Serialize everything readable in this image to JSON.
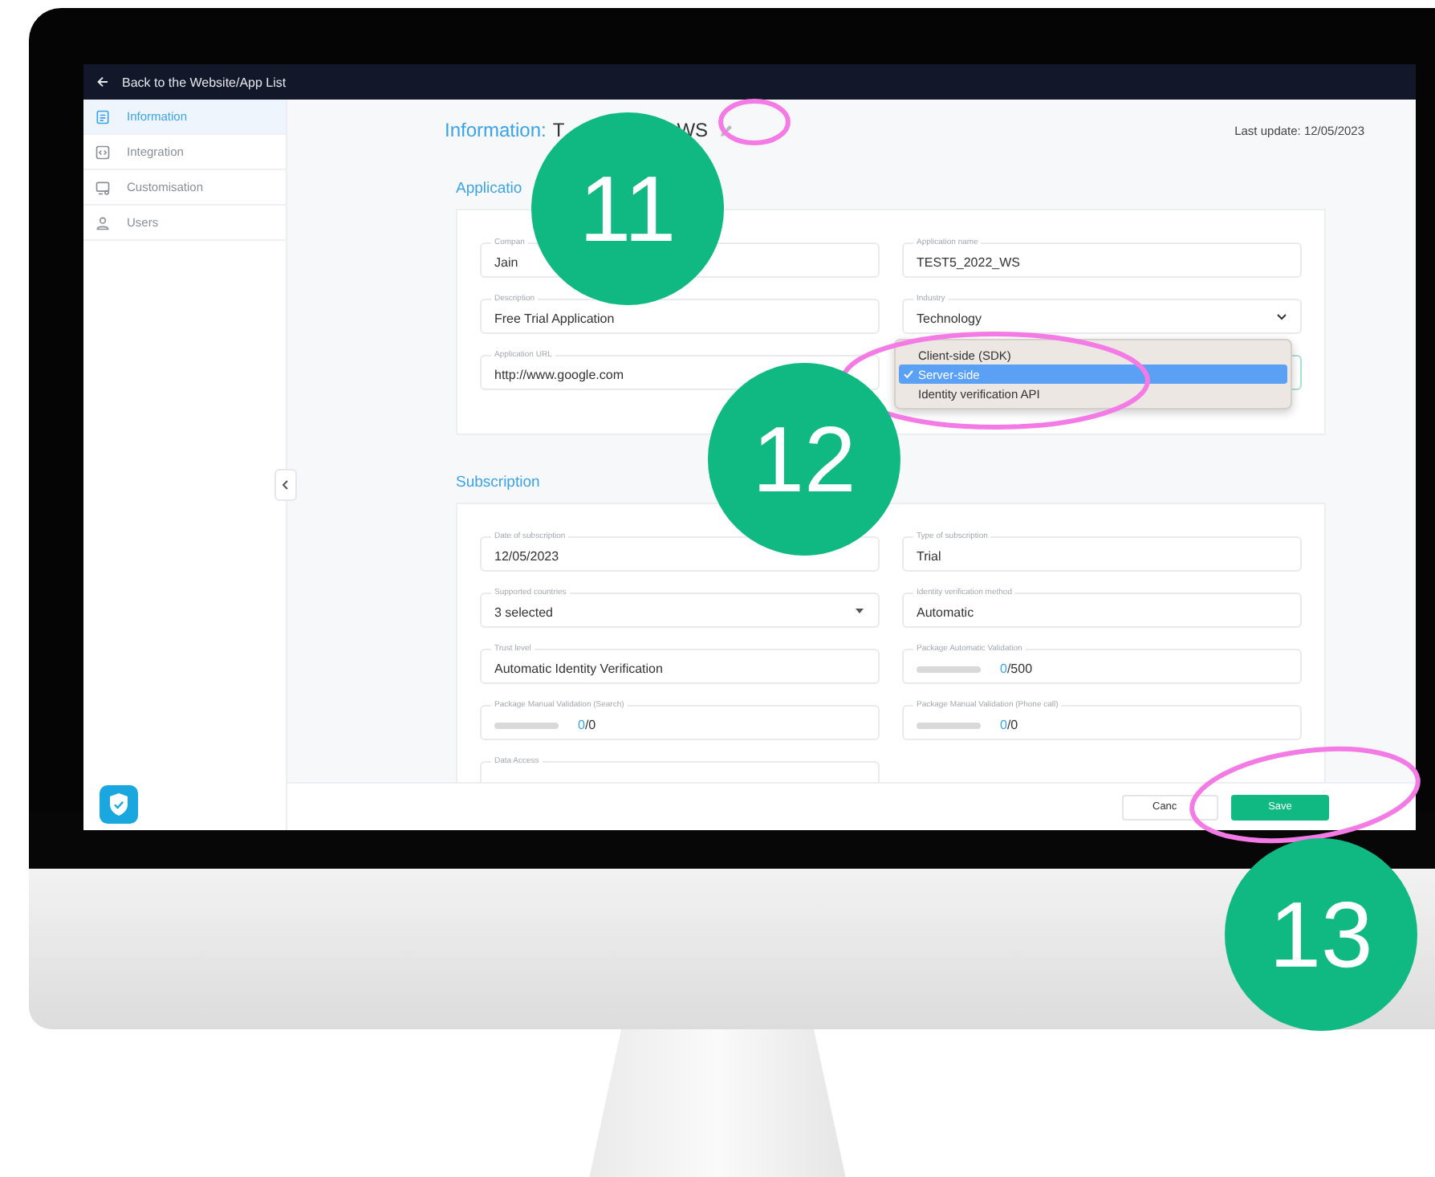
{
  "top_bar": {
    "back_link": "Back to the Website/App List"
  },
  "sidebar": {
    "items": [
      {
        "label": "Information",
        "selected": true
      },
      {
        "label": "Integration",
        "selected": false
      },
      {
        "label": "Customisation",
        "selected": false
      },
      {
        "label": "Users",
        "selected": false
      }
    ]
  },
  "header": {
    "title_label": "Information:",
    "title_name_start": "T",
    "title_name_end": "WS",
    "last_update": "Last update: 12/05/2023"
  },
  "sections": [
    {
      "title": "Applicatio",
      "fields": [
        {
          "kind": "text",
          "label": "Compan",
          "value": "Jain"
        },
        {
          "kind": "text",
          "label": "Application name",
          "value": "TEST5_2022_WS"
        },
        {
          "kind": "text",
          "label": "Description",
          "value": "Free Trial Application"
        },
        {
          "kind": "select",
          "label": "Industry",
          "value": "Technology"
        },
        {
          "kind": "text",
          "label": "Application URL",
          "value": "http://www.google.com"
        },
        {
          "kind": "hidden"
        }
      ]
    },
    {
      "title": "Subscription",
      "fields": [
        {
          "kind": "text",
          "label": "Date of subscription",
          "value": "12/05/2023"
        },
        {
          "kind": "text",
          "label": "Type of subscription",
          "value": "Trial"
        },
        {
          "kind": "dropdown",
          "label": "Supported countries",
          "value": "3 selected"
        },
        {
          "kind": "text",
          "label": "Identity verification method",
          "value": "Automatic"
        },
        {
          "kind": "text",
          "label": "Trust level",
          "value": "Automatic Identity Verification"
        },
        {
          "kind": "meter",
          "label": "Package Automatic Validation",
          "count": "0",
          "limit": "/500",
          "level": 0
        },
        {
          "kind": "meter",
          "label": "Package Manual Validation (Search)",
          "count": "0",
          "limit": "/0",
          "level": 0
        },
        {
          "kind": "meter",
          "label": "Package Manual Validation (Phone call)",
          "count": "0",
          "limit": "/0",
          "level": 0
        },
        {
          "kind": "text",
          "label": "Data Access"
        }
      ]
    }
  ],
  "popup_menu": {
    "options": [
      {
        "label": "Client-side (SDK)",
        "selected": false
      },
      {
        "label": "Server-side",
        "selected": true
      },
      {
        "label": "Identity verification API",
        "selected": false
      }
    ]
  },
  "footer": {
    "cancel": "Canc",
    "save": "Save"
  },
  "callouts": [
    "11",
    "12",
    "13"
  ]
}
